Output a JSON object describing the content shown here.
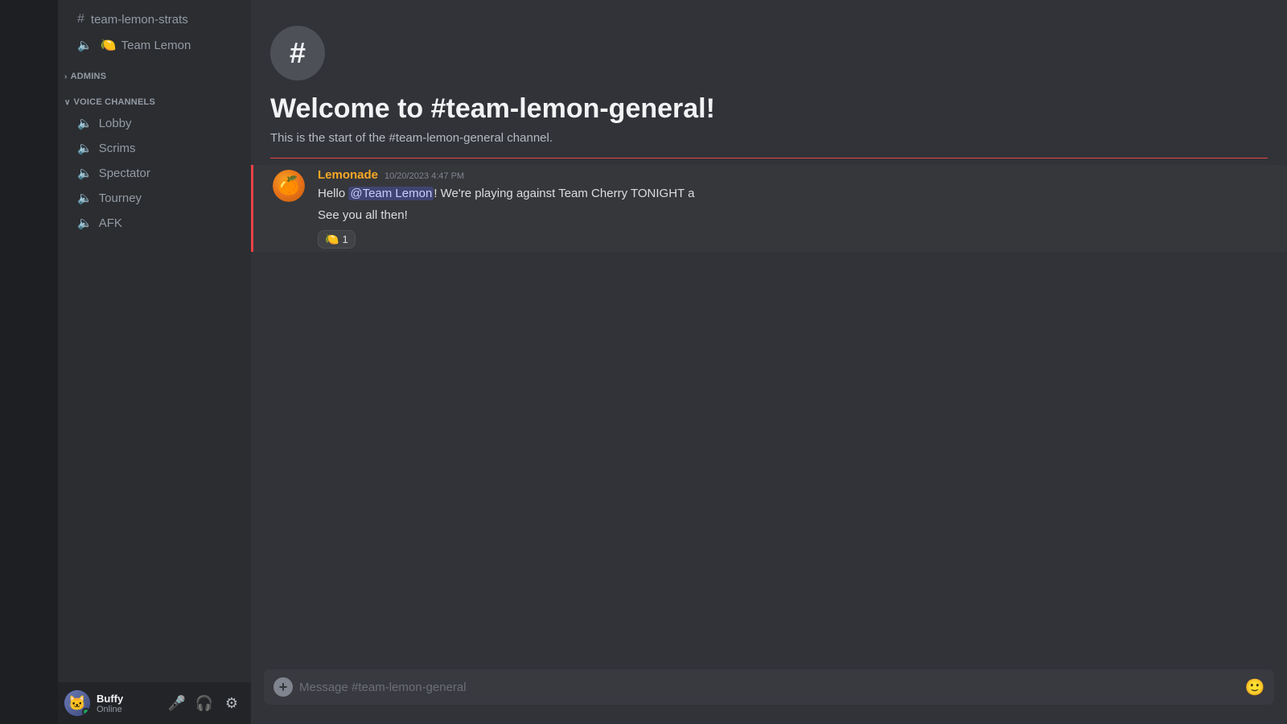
{
  "server_strip": {},
  "sidebar": {
    "channels": [
      {
        "type": "text",
        "icon": "#",
        "name": "team-lemon-strats",
        "active": false
      }
    ],
    "voice_category": "TEAM LEMON",
    "team_lemon_channel": {
      "emoji": "🍋",
      "name": "Team Lemon"
    },
    "admins_section": {
      "label": "ADMINS",
      "collapsed": true
    },
    "voice_channels_section": {
      "label": "VOICE CHANNELS",
      "channels": [
        {
          "name": "Lobby"
        },
        {
          "name": "Scrims"
        },
        {
          "name": "Spectator"
        },
        {
          "name": "Tourney"
        },
        {
          "name": "AFK"
        }
      ]
    }
  },
  "user_area": {
    "name": "Buffy",
    "status": "Online",
    "avatar_emoji": "🐱",
    "controls": {
      "mic": "🎤",
      "headphones": "🎧",
      "settings": "⚙"
    }
  },
  "main": {
    "channel_name": "team-lemon-general",
    "intro": {
      "icon": "#",
      "title": "Welcome to #team-lemon-general!",
      "description": "This is the start of the #team-lemon-general channel."
    },
    "messages": [
      {
        "author": "Lemonade",
        "timestamp": "10/20/2023 4:47 PM",
        "lines": [
          "Hello @Team Lemon! We're playing against Team Cherry TONIGHT a",
          "See you all then!"
        ],
        "mention": "@Team Lemon",
        "reaction_emoji": "🍋",
        "reaction_count": "1"
      }
    ],
    "input_placeholder": "Message #team-lemon-general"
  }
}
